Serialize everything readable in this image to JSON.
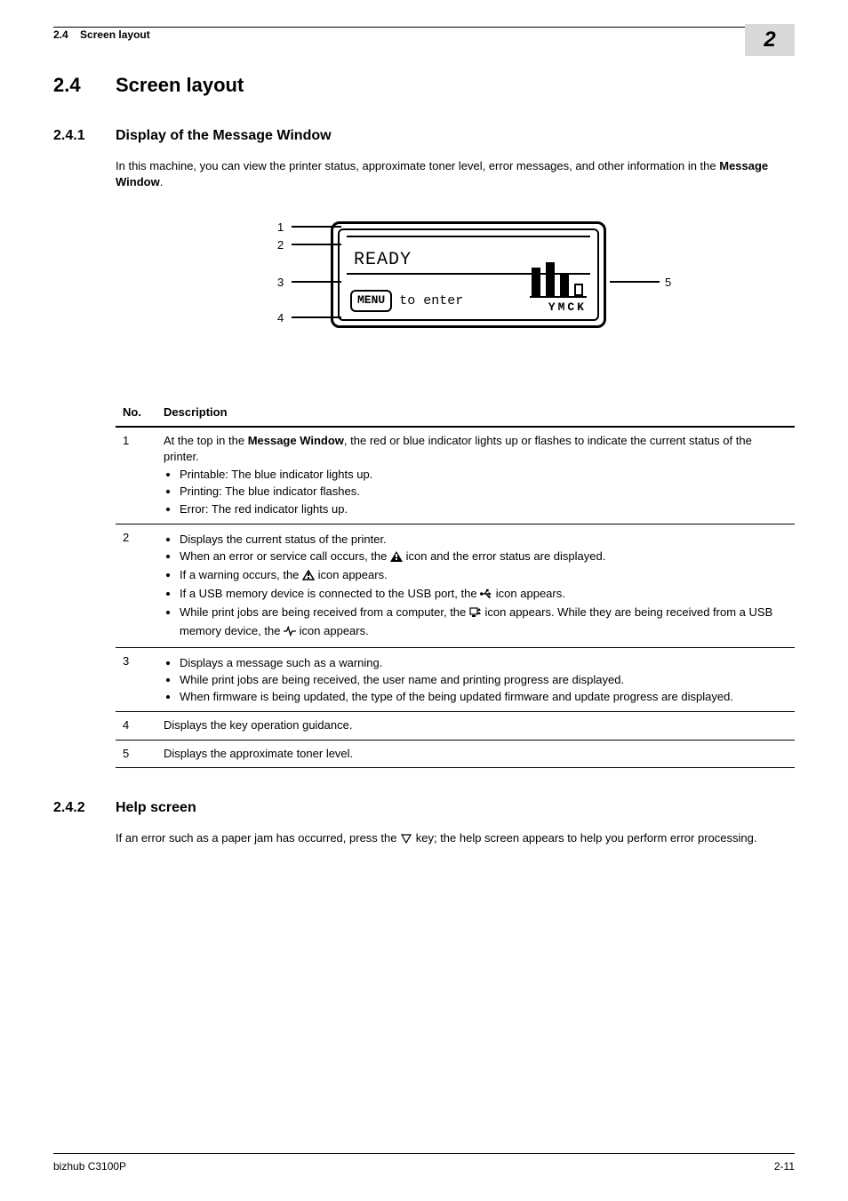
{
  "header": {
    "section_number": "2.4",
    "section_title": "Screen layout",
    "corner_chapter": "2"
  },
  "h1": {
    "number": "2.4",
    "title": "Screen layout"
  },
  "s1": {
    "number": "2.4.1",
    "title": "Display of the Message Window",
    "intro_prefix": "In this machine, you can view the printer status, approximate toner level, error messages, and other information in the ",
    "intro_bold": "Message Window",
    "intro_suffix": "."
  },
  "diagram": {
    "ready": "READY",
    "menu_label": "MENU",
    "menu_text": "to enter",
    "ymck": "YMCK",
    "c1": "1",
    "c2": "2",
    "c3": "3",
    "c4": "4",
    "c5": "5"
  },
  "table": {
    "head_no": "No.",
    "head_desc": "Description",
    "rows": [
      {
        "no": "1",
        "lead_a": "At the top in the ",
        "lead_b": "Message Window",
        "lead_c": ", the red or blue indicator lights up or flashes to indicate the current status of the printer.",
        "bullets": [
          "Printable: The blue indicator lights up.",
          "Printing: The blue indicator flashes.",
          "Error: The red indicator lights up."
        ]
      },
      {
        "no": "2",
        "lead": "",
        "bullets_special": {
          "b1": "Displays the current status of the printer.",
          "b2a": "When an error or service call occurs, the ",
          "b2b": " icon and the error status are displayed.",
          "b3a": "If a warning occurs, the ",
          "b3b": " icon appears.",
          "b4a": "If a USB memory device is connected to the USB port, the ",
          "b4b": " icon appears.",
          "b5a": "While print jobs are being received from a computer, the ",
          "b5b": " icon appears. While they are being received from a USB memory device, the ",
          "b5c": " icon appears."
        }
      },
      {
        "no": "3",
        "bullets": [
          "Displays a message such as a warning.",
          "While print jobs are being received, the user name and printing progress are displayed.",
          "When firmware is being updated, the type of the being updated firmware and update progress are displayed."
        ]
      },
      {
        "no": "4",
        "plain": "Displays the key operation guidance."
      },
      {
        "no": "5",
        "plain": "Displays the approximate toner level."
      }
    ]
  },
  "s2": {
    "number": "2.4.2",
    "title": "Help screen",
    "para_a": "If an error such as a paper jam has occurred, press the ",
    "para_b": " key; the help screen appears to help you perform error processing."
  },
  "footer": {
    "left": "bizhub C3100P",
    "right": "2-11"
  }
}
